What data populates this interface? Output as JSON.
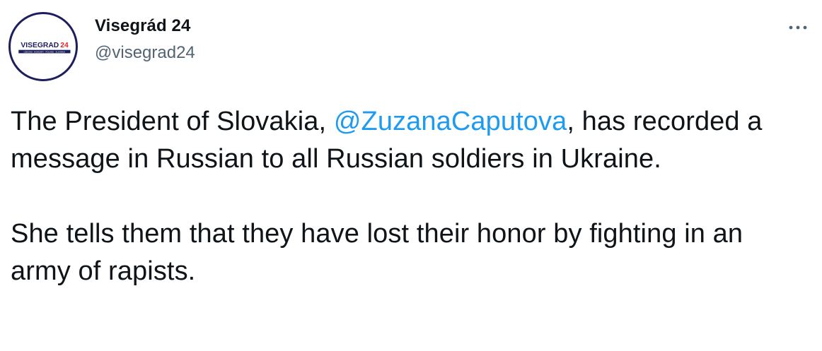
{
  "author": {
    "display_name": "Visegrád 24",
    "handle": "@visegrad24",
    "avatar": {
      "logo_text_main": "VISEGRAD",
      "logo_text_accent": "24",
      "logo_subtext": "CZECHIA · HUNGARY · POLAND · SLOVAKIA",
      "colors": {
        "navy": "#1d1f5c",
        "red": "#e0242b"
      }
    }
  },
  "more_icon": "more-horizontal-icon",
  "tweet": {
    "paragraph1": {
      "before": "The President of Slovakia, ",
      "mention": "@ZuzanaCaputova",
      "after": ", has recorded a message in Russian to all Russian soldiers in Ukraine."
    },
    "paragraph2": "She tells them that they have lost their honor by fighting in an army of rapists."
  },
  "colors": {
    "text": "#0f1419",
    "secondary": "#536471",
    "link": "#1d9bf0"
  }
}
